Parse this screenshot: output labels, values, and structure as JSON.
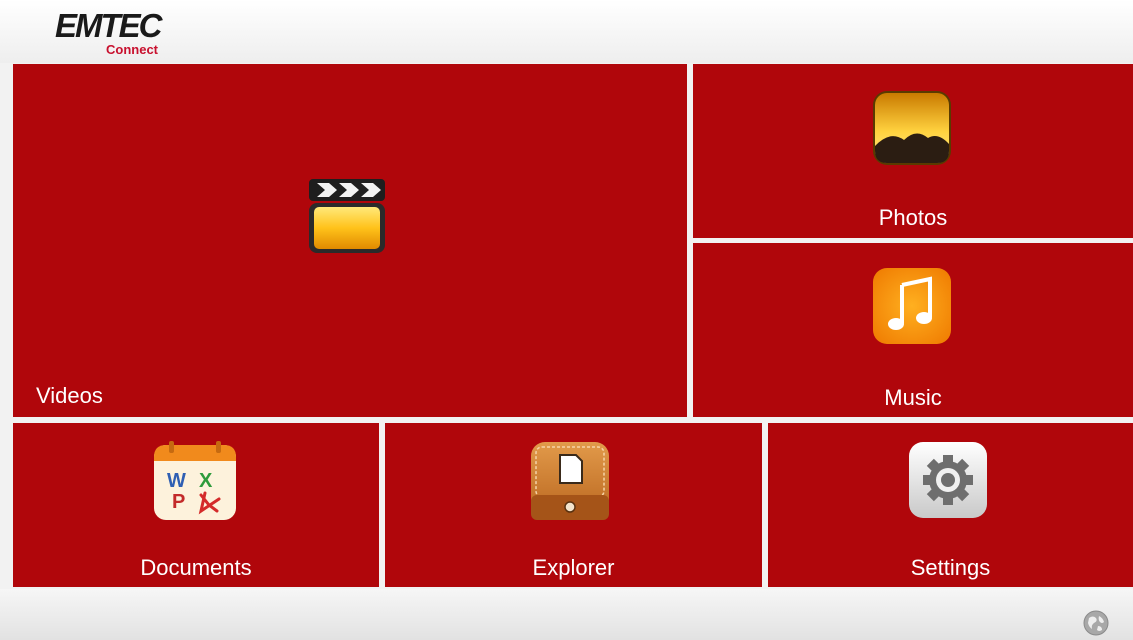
{
  "header": {
    "logo_main": "EMTEC",
    "logo_sub": "Connect"
  },
  "tiles": {
    "videos": {
      "label": "Videos",
      "icon": "clapperboard-icon"
    },
    "photos": {
      "label": "Photos",
      "icon": "landscape-photo-icon"
    },
    "music": {
      "label": "Music",
      "icon": "music-note-icon"
    },
    "documents": {
      "label": "Documents",
      "icon": "office-documents-icon"
    },
    "explorer": {
      "label": "Explorer",
      "icon": "file-explorer-icon"
    },
    "settings": {
      "label": "Settings",
      "icon": "gear-icon"
    }
  },
  "footer": {
    "icon": "globe-icon"
  },
  "colors": {
    "tile_red": "#b0060b",
    "background": "#f2f2f2",
    "label": "#ffffff",
    "logo_accent": "#c8102e"
  }
}
